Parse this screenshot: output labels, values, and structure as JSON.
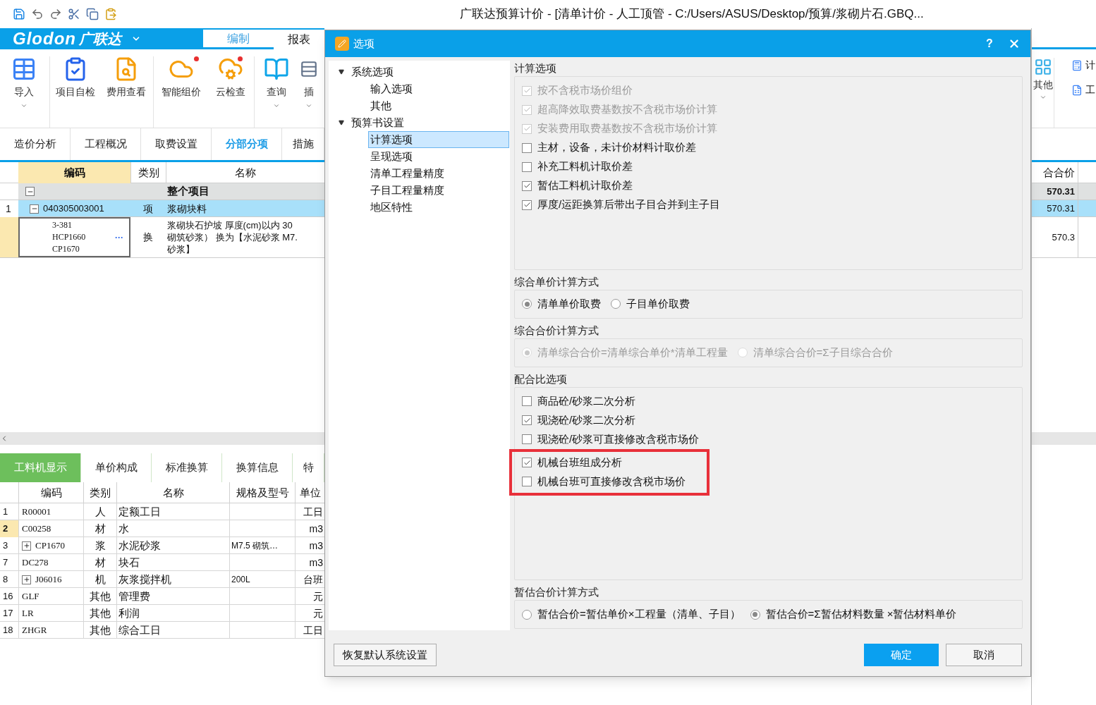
{
  "window": {
    "title": "广联达预算计价 - [清单计价 - 人工顶管 - C:/Users/ASUS/Desktop/预算/浆砌片石.GBQ..."
  },
  "logo": {
    "latin": "Glodon",
    "chinese": "广联达"
  },
  "ribbon_tabs": [
    {
      "label": "编制",
      "selected": true
    },
    {
      "label": "报表",
      "selected": false
    }
  ],
  "ribbon_buttons": [
    {
      "label": "导入",
      "dropdown": true,
      "notification": false
    },
    {
      "label": "项目自检",
      "dropdown": false,
      "notification": false
    },
    {
      "label": "费用查看",
      "dropdown": false,
      "notification": false
    },
    {
      "label": "智能组价",
      "dropdown": false,
      "notification": true
    },
    {
      "label": "云检查",
      "dropdown": false,
      "notification": true
    },
    {
      "label": "查询",
      "dropdown": true,
      "notification": false
    },
    {
      "label": "插",
      "dropdown": true,
      "notification": false
    }
  ],
  "ribbon_right": {
    "large": [
      {
        "label": "其他",
        "dropdown": true
      }
    ],
    "small": [
      {
        "label": "计"
      },
      {
        "label": "工"
      }
    ]
  },
  "view_tabs": [
    {
      "label": "造价分析",
      "selected": false
    },
    {
      "label": "工程概况",
      "selected": false
    },
    {
      "label": "取费设置",
      "selected": false
    },
    {
      "label": "分部分项",
      "selected": true
    },
    {
      "label": "措施",
      "selected": false
    }
  ],
  "grid": {
    "columns": [
      "编码",
      "类别",
      "名称",
      "合合价"
    ],
    "rows": [
      {
        "kind": "group",
        "expanded": true,
        "name": "整个项目",
        "total": "570.31"
      },
      {
        "kind": "list",
        "no": "1",
        "expanded": true,
        "code": "040305003001",
        "type": "项",
        "name": "浆砌块料",
        "total": "570.31"
      },
      {
        "kind": "quota",
        "code_lines": [
          "3-381",
          "HCP1660",
          "CP1670"
        ],
        "more": "···",
        "type": "换",
        "name_lines": [
          "浆砌块石护坡 厚度(cm)以内 30",
          "砌筑砂浆） 换为【水泥砂浆 M7.",
          "砂浆】"
        ],
        "total": "570.3"
      }
    ]
  },
  "detail_tabs": [
    {
      "label": "工料机显示",
      "selected": true
    },
    {
      "label": "单价构成",
      "selected": false
    },
    {
      "label": "标准换算",
      "selected": false
    },
    {
      "label": "换算信息",
      "selected": false
    },
    {
      "label": "特",
      "selected": false
    }
  ],
  "detail_table": {
    "columns": [
      "编码",
      "类别",
      "名称",
      "规格及型号",
      "单位"
    ],
    "rows": [
      {
        "no": "1",
        "kind": "leaf",
        "code": "R00001",
        "type": "人",
        "name": "定额工日",
        "unit": "工日",
        "selected": false
      },
      {
        "no": "2",
        "kind": "leaf",
        "code": "C00258",
        "type": "材",
        "name": "水",
        "unit": "m3",
        "selected": true
      },
      {
        "no": "3",
        "kind": "group",
        "code": "CP1670",
        "type": "浆",
        "name": "水泥砂浆",
        "spec": "M7.5 砌筑…",
        "unit": "m3",
        "selected": false
      },
      {
        "no": "7",
        "kind": "leaf",
        "code": "DC278",
        "type": "材",
        "name": "块石",
        "unit": "m3",
        "selected": false
      },
      {
        "no": "8",
        "kind": "group",
        "code": "J06016",
        "type": "机",
        "name": "灰浆搅拌机",
        "spec": "200L",
        "unit": "台班",
        "selected": false
      },
      {
        "no": "16",
        "kind": "leaf",
        "code": "GLF",
        "type": "其他",
        "name": "管理费",
        "unit": "元",
        "selected": false
      },
      {
        "no": "17",
        "kind": "leaf",
        "code": "LR",
        "type": "其他",
        "name": "利润",
        "unit": "元",
        "selected": false
      },
      {
        "no": "18",
        "kind": "leaf",
        "code": "ZHGR",
        "type": "其他",
        "name": "综合工日",
        "unit": "工日",
        "selected": false
      }
    ]
  },
  "dialog": {
    "title": "选项",
    "help": "?",
    "tree": [
      {
        "label": "系统选项",
        "expanded": true,
        "selected": false,
        "children": [
          {
            "label": "输入选项",
            "selected": false
          },
          {
            "label": "其他",
            "selected": false
          }
        ]
      },
      {
        "label": "预算书设置",
        "expanded": true,
        "selected": false,
        "children": [
          {
            "label": "计算选项",
            "selected": true
          },
          {
            "label": "呈现选项",
            "selected": false
          },
          {
            "label": "清单工程量精度",
            "selected": false
          },
          {
            "label": "子目工程量精度",
            "selected": false
          },
          {
            "label": "地区特性",
            "selected": false
          }
        ]
      }
    ],
    "groups": [
      {
        "kind": "checkboxes",
        "title": "计算选项",
        "items": [
          {
            "label": "按不含税市场价组价",
            "checked": true,
            "disabled": true
          },
          {
            "label": "超高降效取费基数按不含税市场价计算",
            "checked": true,
            "disabled": true
          },
          {
            "label": "安装费用取费基数按不含税市场价计算",
            "checked": true,
            "disabled": true
          },
          {
            "label": "主材，设备，未计价材料计取价差",
            "checked": false,
            "disabled": false
          },
          {
            "label": "补充工料机计取价差",
            "checked": false,
            "disabled": false
          },
          {
            "label": "暂估工料机计取价差",
            "checked": true,
            "disabled": false
          },
          {
            "label": "厚度/运距换算后带出子目合并到主子目",
            "checked": true,
            "disabled": false
          }
        ]
      },
      {
        "kind": "radios",
        "title": "综合单价计算方式",
        "items": [
          {
            "label": "清单单价取费",
            "selected": true,
            "disabled": false
          },
          {
            "label": "子目单价取费",
            "selected": false,
            "disabled": false
          }
        ]
      },
      {
        "kind": "radios",
        "title": "综合合价计算方式",
        "items": [
          {
            "label": "清单综合合价=清单综合单价*清单工程量",
            "selected": true,
            "disabled": true
          },
          {
            "label": "清单综合合价=Σ子目综合合价",
            "selected": false,
            "disabled": true
          }
        ]
      },
      {
        "kind": "checkboxes",
        "title": "配合比选项",
        "items": [
          {
            "label": "商品砼/砂浆二次分析",
            "checked": false,
            "disabled": false,
            "highlighted": false
          },
          {
            "label": "现浇砼/砂浆二次分析",
            "checked": true,
            "disabled": false,
            "highlighted": false
          },
          {
            "label": "现浇砼/砂浆可直接修改含税市场价",
            "checked": false,
            "disabled": false,
            "highlighted": false
          },
          {
            "label": "机械台班组成分析",
            "checked": true,
            "disabled": false,
            "highlighted": true
          },
          {
            "label": "机械台班可直接修改含税市场价",
            "checked": false,
            "disabled": false,
            "highlighted": true
          }
        ]
      },
      {
        "kind": "radios",
        "title": "暂估合价计算方式",
        "items": [
          {
            "label": "暂估合价=暂估单价×工程量（清单、子目）",
            "selected": false,
            "disabled": false
          },
          {
            "label": "暂估合价=Σ暂估材料数量 ×暂估材料单价",
            "selected": true,
            "disabled": false
          }
        ]
      }
    ],
    "buttons": [
      {
        "label": "恢复默认系统设置",
        "kind": "reset"
      },
      {
        "label": "确定",
        "kind": "primary"
      },
      {
        "label": "取消",
        "kind": "default"
      }
    ]
  }
}
